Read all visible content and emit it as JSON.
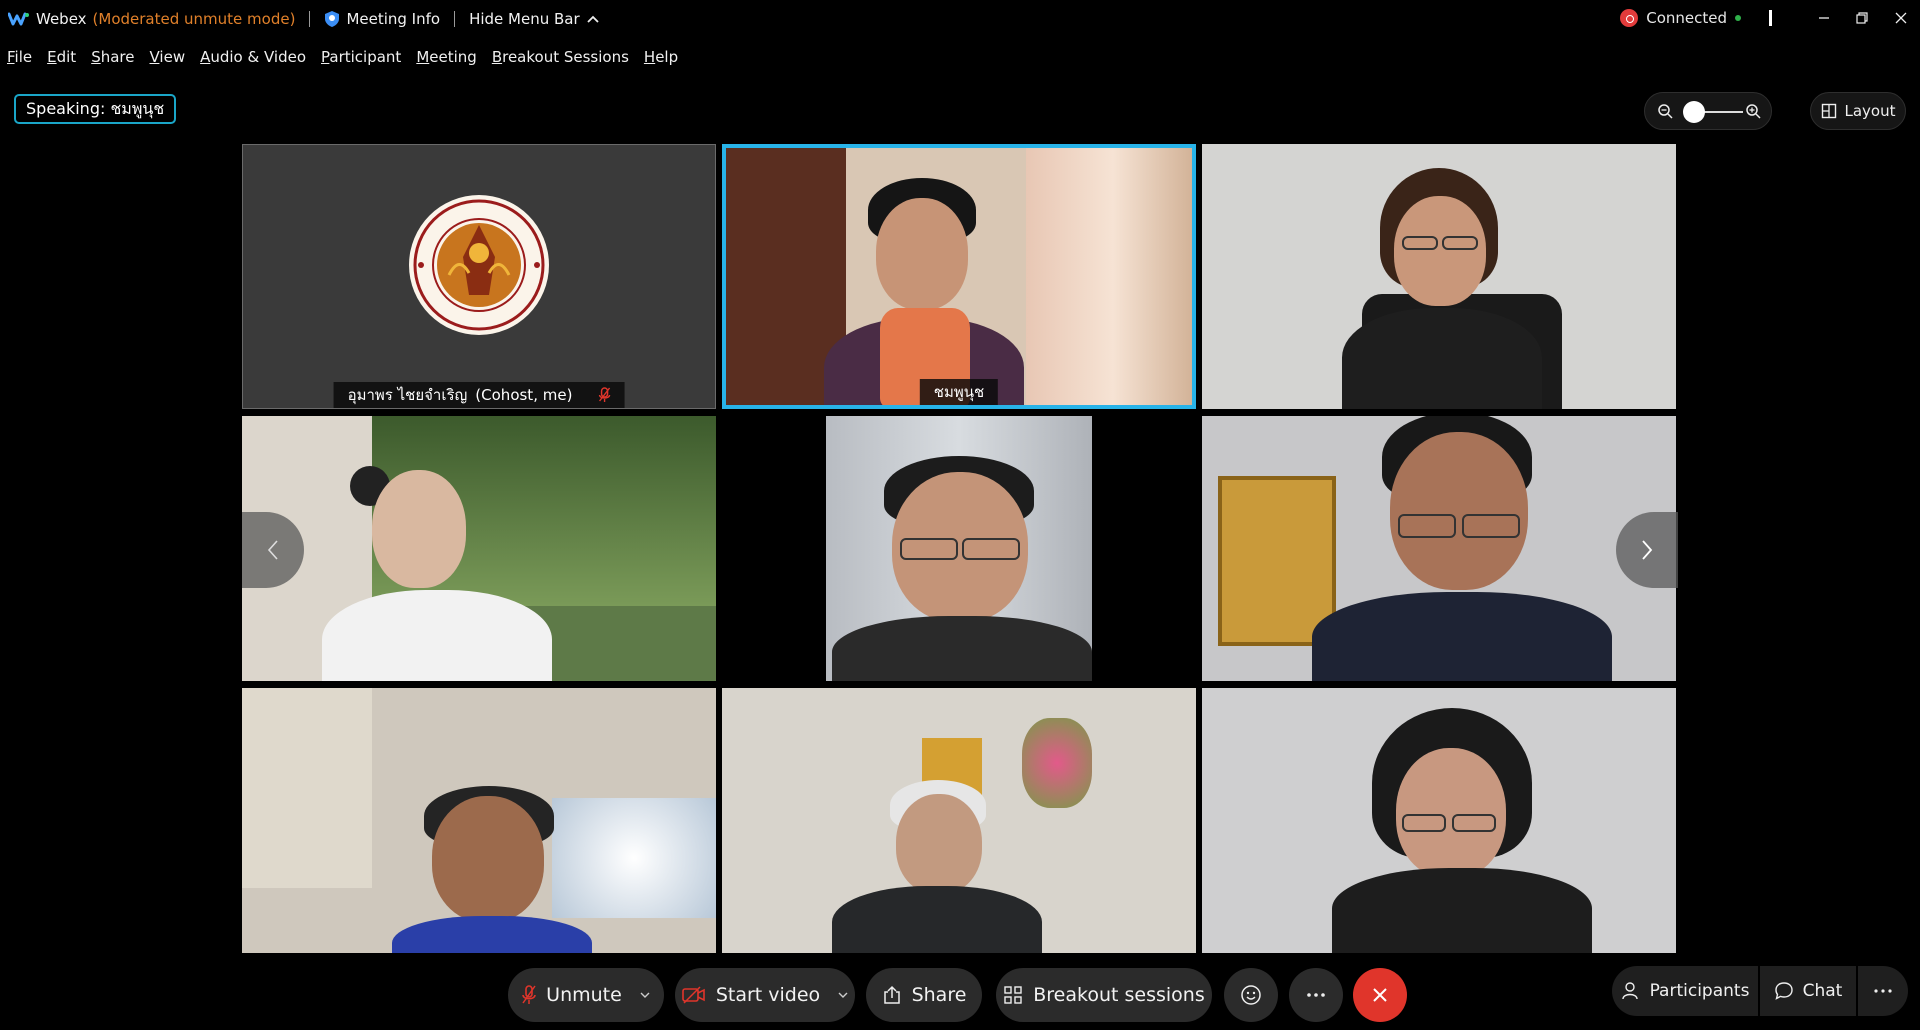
{
  "titlebar": {
    "app_name": "Webex",
    "mode": "(Moderated unmute mode)",
    "meeting_info": "Meeting Info",
    "hide_menu_bar": "Hide Menu Bar",
    "connection_status": "Connected",
    "accent_color": "#e0802a"
  },
  "menu": [
    "File",
    "Edit",
    "Share",
    "View",
    "Audio & Video",
    "Participant",
    "Meeting",
    "Breakout Sessions",
    "Help"
  ],
  "speaking": "Speaking: ชมพูนุช",
  "zoom": {
    "level": 0.1
  },
  "layout_label": "Layout",
  "tiles": [
    {
      "name": "อุมาพร ไชยจำเริญ",
      "suffix": "(Cohost, me)",
      "muted": true,
      "video": false
    },
    {
      "name": "ชมพูนุช",
      "active_speaker": true,
      "video": true
    },
    {
      "name": "",
      "video": true
    },
    {
      "name": "",
      "video": true
    },
    {
      "name": "",
      "video": true
    },
    {
      "name": "",
      "video": true
    },
    {
      "name": "",
      "video": true
    },
    {
      "name": "",
      "video": true
    },
    {
      "name": "",
      "video": true
    }
  ],
  "controls": {
    "unmute": "Unmute",
    "start_video": "Start video",
    "share": "Share",
    "breakout": "Breakout sessions",
    "participants": "Participants",
    "chat": "Chat"
  },
  "colors": {
    "active_border": "#28b3e8",
    "end_call": "#e0352b",
    "muted_mic": "#e0352b"
  }
}
